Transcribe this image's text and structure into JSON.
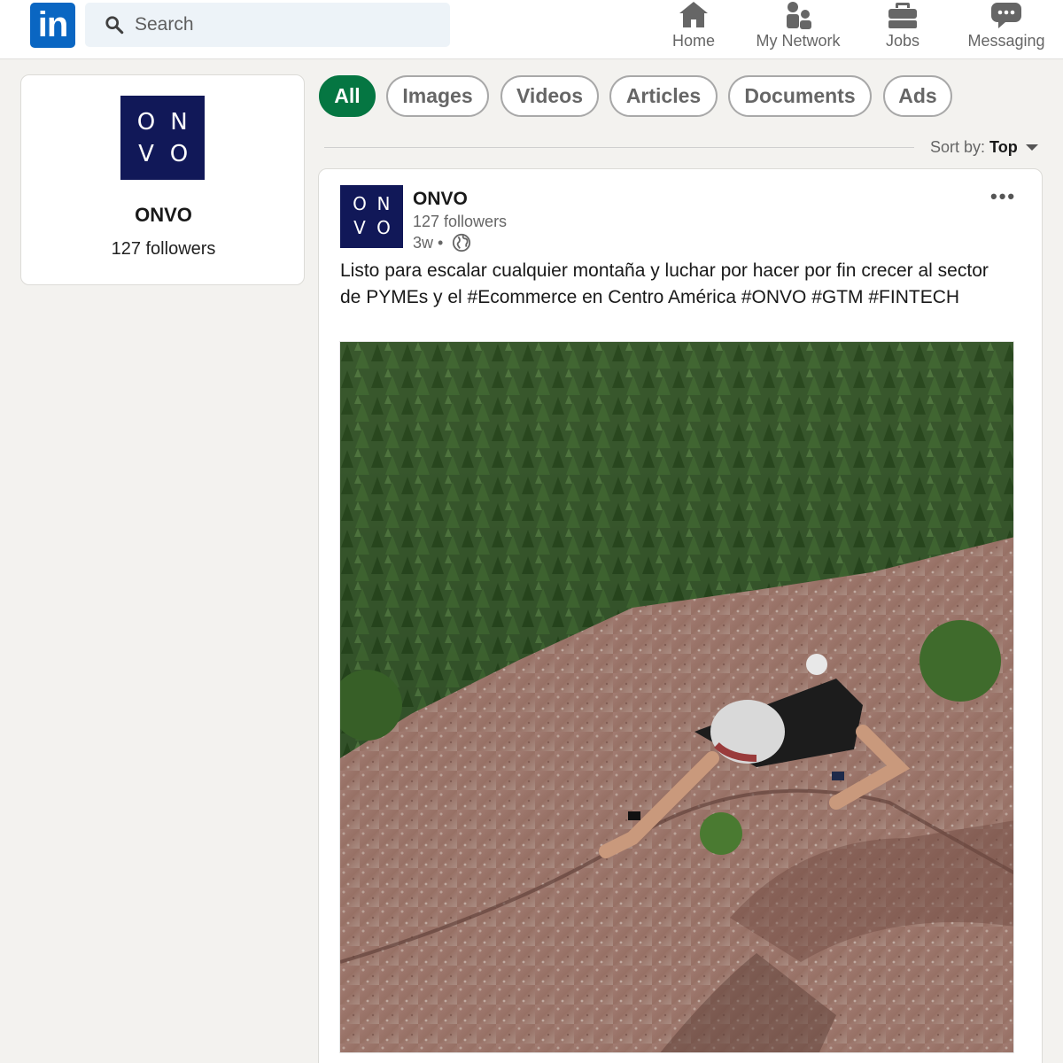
{
  "app": {
    "logo_text": "in"
  },
  "search": {
    "placeholder": "Search"
  },
  "nav": {
    "items": [
      {
        "label": "Home",
        "icon": "home-icon"
      },
      {
        "label": "My Network",
        "icon": "people-icon"
      },
      {
        "label": "Jobs",
        "icon": "briefcase-icon"
      },
      {
        "label": "Messaging",
        "icon": "chat-bubble-icon"
      }
    ]
  },
  "company": {
    "logo_letters": [
      "O",
      "N",
      "V",
      "O"
    ],
    "name": "ONVO",
    "followers": "127 followers"
  },
  "filters": {
    "pills": [
      "All",
      "Images",
      "Videos",
      "Articles",
      "Documents",
      "Ads"
    ],
    "active": "All"
  },
  "sort": {
    "label": "Sort by:",
    "value": "Top"
  },
  "post": {
    "author": "ONVO",
    "followers": "127 followers",
    "time": "3w •",
    "visibility_icon": "globe-icon",
    "menu_icon": "more-horizontal-icon",
    "text": "Listo para escalar cualquier montaña y luchar por hacer por fin crecer al sector de PYMEs y el #Ecommerce en Centro América #ONVO #GTM #FINTECH",
    "image": "photo of a climber scrambling up a reddish granite slab above a pine forest"
  },
  "colors": {
    "linkedin_blue": "#0a66c2",
    "active_pill_green": "#057642",
    "onvo_navy": "#111858",
    "page_bg": "#f3f2ef",
    "search_bg": "#edf3f8"
  }
}
